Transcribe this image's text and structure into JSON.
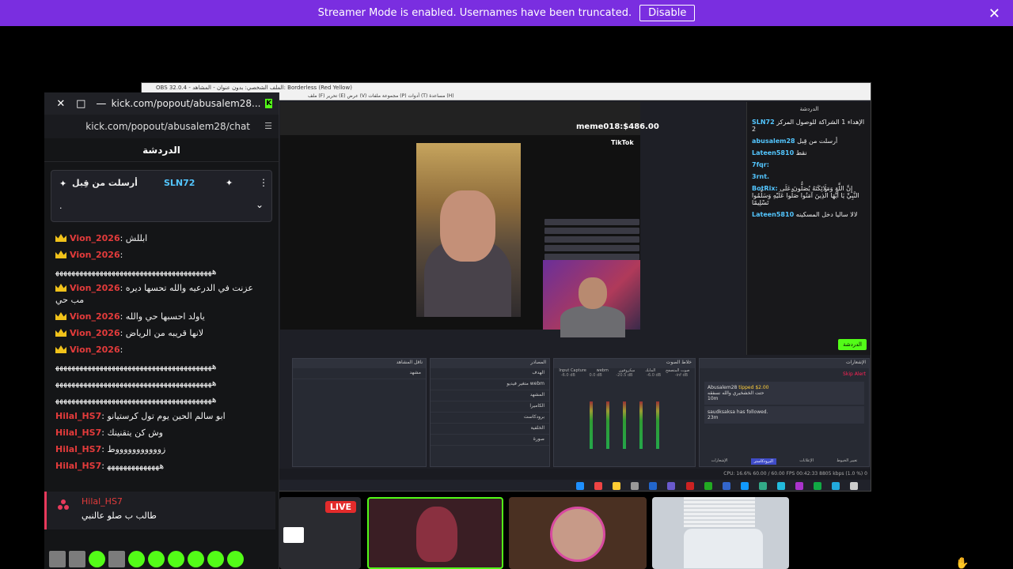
{
  "banner": {
    "text": "Streamer Mode is enabled. Usernames have been truncated.",
    "button": "Disable"
  },
  "kick": {
    "url_title": "kick.com/popout/abusalem28...",
    "url_bar": "kick.com/popout/abusalem28/chat",
    "chat_header": "الدردشة",
    "pinned": {
      "title": "أرسلت من قِبل",
      "user": "SLN72",
      "message": "."
    },
    "messages": [
      {
        "user": "Vion_2026",
        "text": "ابللش",
        "crown": true
      },
      {
        "user": "Vion_2026",
        "text": "",
        "crown": true
      },
      {
        "user": "",
        "text": "ﻫﻬﻬﻬﻬﻬﻬﻬﻬﻬﻬﻬﻬﻬﻬﻬﻬﻬﻬﻬﻬﻬﻬﻬﻬﻬﻬﻬﻬﻬﻬﻬﻬﻬﻬﻬﻬﻬﻬﻬ",
        "crown": false,
        "long": true
      },
      {
        "user": "Vion_2026",
        "text": "عزنت في الدرعيه والله تحسها ديره مب حي",
        "crown": true
      },
      {
        "user": "Vion_2026",
        "text": "ياولد احسبها حي والله",
        "crown": true
      },
      {
        "user": "Vion_2026",
        "text": "لانها قريبه من الرياض",
        "crown": true
      },
      {
        "user": "Vion_2026",
        "text": "",
        "crown": true
      },
      {
        "user": "",
        "text": "ﻫﻬﻬﻬﻬﻬﻬﻬﻬﻬﻬﻬﻬﻬﻬﻬﻬﻬﻬﻬﻬﻬﻬﻬﻬﻬﻬﻬﻬﻬﻬﻬﻬﻬﻬﻬﻬﻬﻬﻬ",
        "crown": false,
        "long": true
      },
      {
        "user": "",
        "text": "ﻫﻬﻬﻬﻬﻬﻬﻬﻬﻬﻬﻬﻬﻬﻬﻬﻬﻬﻬﻬﻬﻬﻬﻬﻬﻬﻬﻬﻬﻬﻬﻬﻬﻬﻬﻬﻬﻬﻬﻬ",
        "crown": false,
        "long": true
      },
      {
        "user": "",
        "text": "ﻫﻬﻬﻬﻬﻬﻬﻬﻬﻬﻬﻬﻬﻬﻬﻬﻬﻬﻬﻬﻬﻬﻬﻬﻬﻬﻬﻬﻬﻬﻬﻬﻬﻬﻬﻬﻬﻬﻬﻬ",
        "crown": false,
        "long": true
      },
      {
        "user": "Hilal_HS7",
        "text": "ابو سالم الحين يوم تول كرستيانو",
        "crown": false
      },
      {
        "user": "Hilal_HS7",
        "text": "وش كن يتقنينك",
        "crown": false
      },
      {
        "user": "Hilal_HS7",
        "text": "زوووووووووووط",
        "crown": false
      },
      {
        "user": "Hilal_HS7",
        "text": "ﻫﻬﻬﻬﻬﻬﻬﻬﻬﻬﻬﻬﻬﻬ",
        "crown": false
      }
    ],
    "reply": {
      "user": "Hilal_HS7",
      "text": "طالب ب صلو عالنبي"
    }
  },
  "obs": {
    "title": "OBS 32.0.4 - الملف الشخصي: بدون عنوان - المشاهد: Borderless (Red Yellow)",
    "menu": "ملف (F)   تحرير (E)   عرض (V)   مجموعة ملفات (P)   أدوات (T)   مساعدة (H)",
    "tiktok_label": "TikTok",
    "overlay_text": "meme018:$486.00",
    "side": {
      "header": "الدردشة",
      "lines": [
        {
          "user": "SLN72",
          "text": "الإهداء 1 الشراكة للوصول المركز 2"
        },
        {
          "user": "abusalem28",
          "text": "أرسلت من قِبل"
        },
        {
          "user": "Lateen5810",
          "text": "نقط"
        },
        {
          "user": "7fqr:",
          "text": ""
        },
        {
          "user": "3rnt.",
          "text": ""
        },
        {
          "user": "BotRix:",
          "text": "إِنَّ اللَّهَ وَمَلَائِكَتَهُ يُصَلُّونَ عَلَى النَّبِيِّ يَا أَيُّهَا الَّذِينَ آمَنُوا صَلُّوا عَلَيْهِ وَسَلِّمُوا تَسْلِيمًا"
        },
        {
          "user": "Lateen5810",
          "text": "لالا ساليا دخل المسكينه"
        }
      ],
      "button": "الدردشة"
    },
    "docks": {
      "scenes": "ناقل المشاهد",
      "sources": "المصادر",
      "mixer": "خلاط الصوت",
      "events": "الإشعارات",
      "scene_row": "مشهد",
      "source_rows": [
        "الهدف",
        "متغير فيديو webm",
        "المشهد",
        "الكاميرا",
        "برودكاست",
        "الخلفية",
        "صورة"
      ],
      "mixer_channels": [
        "صوت المتصفح",
        "المايك",
        "ميكروفون",
        "webm",
        "Input Capture"
      ],
      "mixer_levels": [
        "-inf dB",
        "-6.0 dB",
        "-20.5 dB",
        "0.0 dB",
        "-6.0 dB"
      ],
      "events_items": [
        {
          "user": "Abusalem28",
          "text": "tipped $2.00",
          "sub": "حتت الخشخيري والله نسفقه",
          "time": "10m"
        },
        {
          "user": "saudksaksa",
          "text": "has followed.",
          "time": "23m"
        }
      ],
      "skip_alert": "Skip Alert",
      "bottom_tabs": [
        "الإشعارات",
        "البرودكاستر",
        "الإعلانات",
        "تغيير الخيوط"
      ]
    },
    "status": "CPU: 16.6%   60.00 / 60.00 FPS   00:42:33   8805 kbps   (1.0 %) 0"
  },
  "thumbnails": {
    "live_badge": "LIVE"
  }
}
